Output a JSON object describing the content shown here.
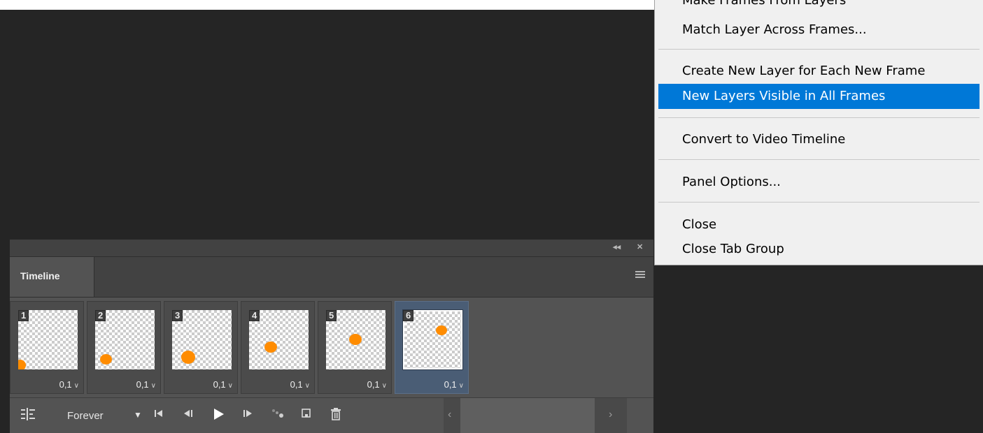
{
  "menu": {
    "cut_item": "Make Frames From Layers",
    "items": [
      {
        "label": "Match Layer Across Frames...",
        "highlighted": false
      },
      {
        "label": "Create New Layer for Each New Frame",
        "highlighted": false
      },
      {
        "label": "New Layers Visible in All Frames",
        "highlighted": true
      },
      {
        "label": "Convert to Video Timeline",
        "highlighted": false
      },
      {
        "label": "Panel Options...",
        "highlighted": false
      },
      {
        "label": "Close",
        "highlighted": false
      },
      {
        "label": "Close Tab Group",
        "highlighted": false
      }
    ],
    "highlight_color": "#0078d7"
  },
  "panel": {
    "collapse_glyph": "◂◂",
    "close_glyph": "✕",
    "tab_label": "Timeline",
    "frames": [
      {
        "number": "1",
        "delay": "0,1",
        "selected": false
      },
      {
        "number": "2",
        "delay": "0,1",
        "selected": false
      },
      {
        "number": "3",
        "delay": "0,1",
        "selected": false
      },
      {
        "number": "4",
        "delay": "0,1",
        "selected": false
      },
      {
        "number": "5",
        "delay": "0,1",
        "selected": false
      },
      {
        "number": "6",
        "delay": "0,1",
        "selected": true
      }
    ],
    "delay_arrow": "∨",
    "loop_label": "Forever",
    "loop_arrow": "▼",
    "icons": {
      "convert": "timeline-convert-icon",
      "first": "first-frame-icon",
      "prev": "previous-frame-icon",
      "play": "play-icon",
      "next": "next-frame-icon",
      "tween": "tween-icon",
      "duplicate": "duplicate-frame-icon",
      "delete": "delete-frame-icon"
    },
    "scroll_left": "‹",
    "scroll_right": "›"
  },
  "colors": {
    "dot": "#ff8c00",
    "selected_frame": "#4a5d75"
  }
}
